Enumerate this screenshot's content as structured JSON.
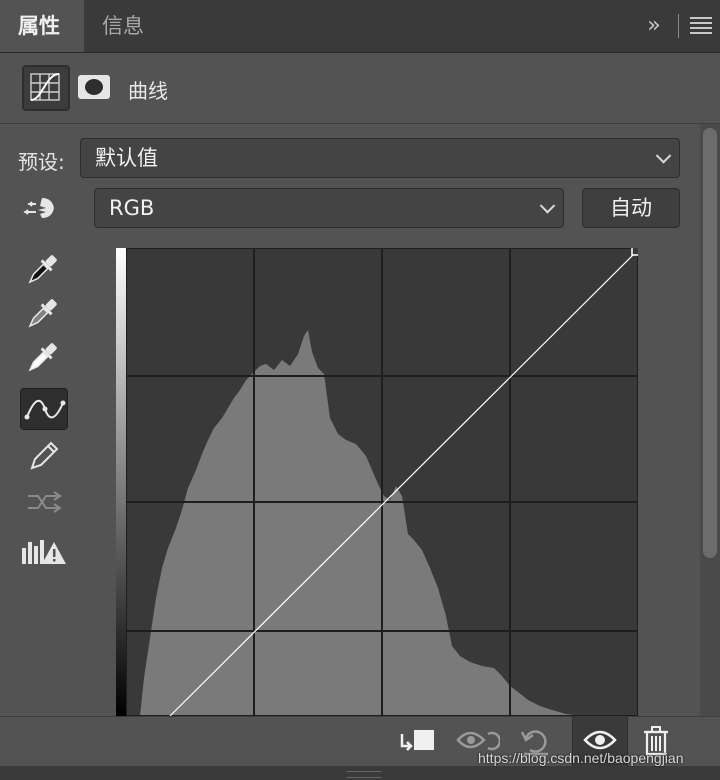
{
  "tabs": {
    "properties": "属性",
    "info": "信息"
  },
  "header_icons": {
    "collapse": "»",
    "menu": "hamburger-icon"
  },
  "adjustment": {
    "title": "曲线"
  },
  "preset": {
    "label": "预设:",
    "value": "默认值"
  },
  "channel": {
    "value": "RGB",
    "auto_label": "自动"
  },
  "tools": [
    "on-image-adjust-icon",
    "black-point-eyedropper-icon",
    "gray-point-eyedropper-icon",
    "white-point-eyedropper-icon",
    "curve-point-tool-icon",
    "pencil-icon",
    "smooth-curve-icon",
    "clipping-warning-icon"
  ],
  "footer_icons": [
    "clip-to-layer-icon",
    "view-previous-icon",
    "reset-icon",
    "visibility-eye-icon",
    "trash-icon"
  ],
  "watermark": "https://blog.csdn.net/baopengjian",
  "colors": {
    "panel": "#535353",
    "tabbar": "#3a3a3a",
    "histogram": "#7a7a7a",
    "curve_bg": "#393939",
    "curve_line": "#ffffff"
  }
}
